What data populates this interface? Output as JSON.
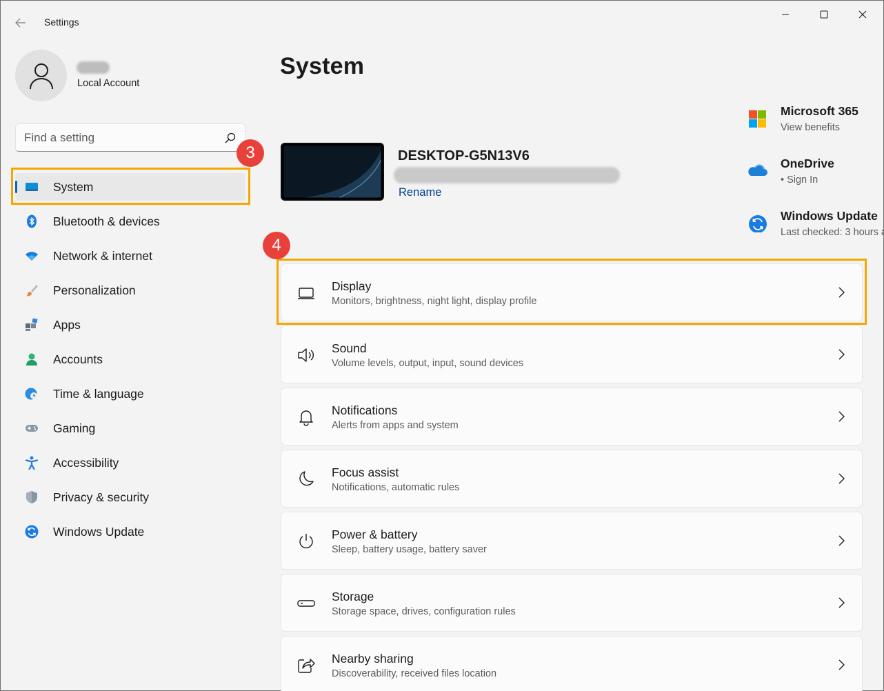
{
  "window": {
    "title": "Settings",
    "controls": {
      "minimize": "–",
      "maximize": "□",
      "close": "✕"
    }
  },
  "profile": {
    "name": "",
    "account_type": "Local Account"
  },
  "search": {
    "placeholder": "Find a setting",
    "value": ""
  },
  "sidebar": {
    "items": [
      {
        "label": "System",
        "icon": "system-monitor-icon",
        "active": true
      },
      {
        "label": "Bluetooth & devices",
        "icon": "bluetooth-icon"
      },
      {
        "label": "Network & internet",
        "icon": "wifi-icon"
      },
      {
        "label": "Personalization",
        "icon": "paintbrush-icon"
      },
      {
        "label": "Apps",
        "icon": "apps-icon"
      },
      {
        "label": "Accounts",
        "icon": "person-icon"
      },
      {
        "label": "Time & language",
        "icon": "globe-clock-icon"
      },
      {
        "label": "Gaming",
        "icon": "gamepad-icon"
      },
      {
        "label": "Accessibility",
        "icon": "accessibility-icon"
      },
      {
        "label": "Privacy & security",
        "icon": "shield-icon"
      },
      {
        "label": "Windows Update",
        "icon": "update-icon"
      }
    ]
  },
  "annotations": {
    "step_3": "3",
    "step_4": "4",
    "highlight_color": "#f5a700",
    "badge_color": "#e8413b"
  },
  "main": {
    "page_title": "System",
    "device": {
      "name": "DESKTOP-G5N13V6",
      "model": "",
      "rename_label": "Rename"
    },
    "side_cards": [
      {
        "title": "Microsoft 365",
        "subtitle": "View benefits",
        "icon": "microsoft-logo-icon"
      },
      {
        "title": "OneDrive",
        "subtitle": "• Sign In",
        "icon": "onedrive-cloud-icon"
      },
      {
        "title": "Windows Update",
        "subtitle": "Last checked: 3 hours a",
        "icon": "update-icon"
      }
    ],
    "settings": [
      {
        "title": "Display",
        "subtitle": "Monitors, brightness, night light, display profile",
        "icon": "laptop-icon"
      },
      {
        "title": "Sound",
        "subtitle": "Volume levels, output, input, sound devices",
        "icon": "speaker-icon"
      },
      {
        "title": "Notifications",
        "subtitle": "Alerts from apps and system",
        "icon": "bell-icon"
      },
      {
        "title": "Focus assist",
        "subtitle": "Notifications, automatic rules",
        "icon": "moon-icon"
      },
      {
        "title": "Power & battery",
        "subtitle": "Sleep, battery usage, battery saver",
        "icon": "power-icon"
      },
      {
        "title": "Storage",
        "subtitle": "Storage space, drives, configuration rules",
        "icon": "storage-drive-icon"
      },
      {
        "title": "Nearby sharing",
        "subtitle": "Discoverability, received files location",
        "icon": "share-icon"
      }
    ]
  },
  "colors": {
    "accent": "#0067c0",
    "link": "#003e92",
    "background": "#f3f3f3",
    "card": "#fbfbfb"
  }
}
